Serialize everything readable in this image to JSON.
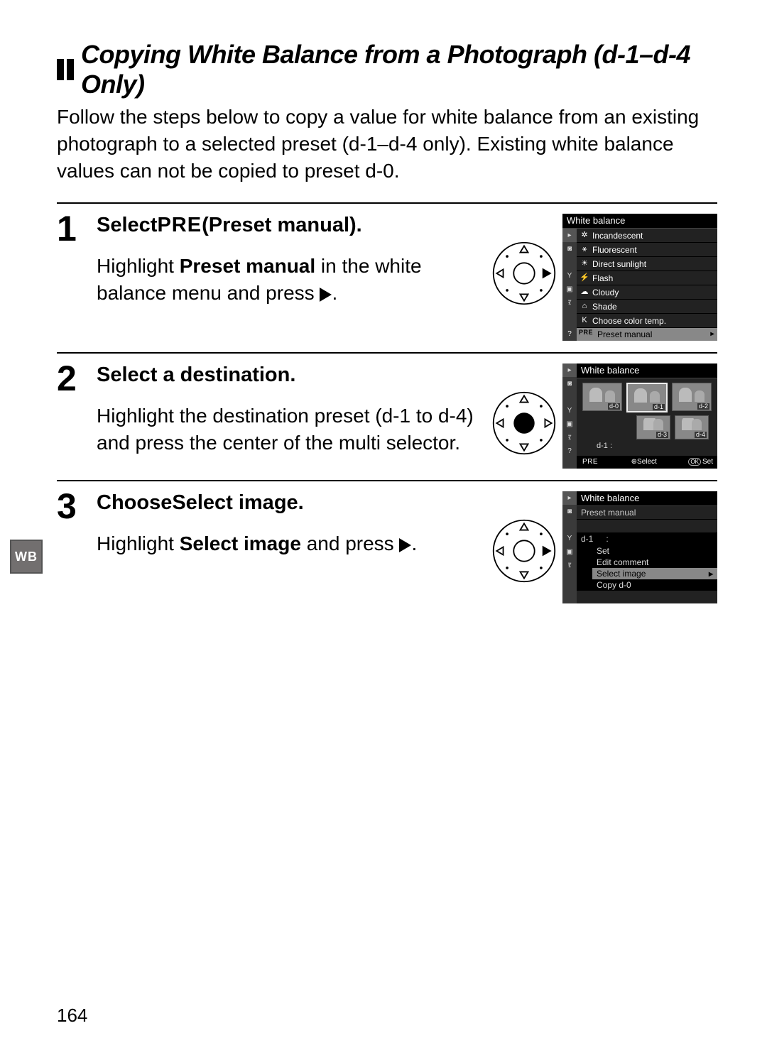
{
  "heading": "Copying White Balance from a Photograph (d-1–d-4 Only)",
  "intro": "Follow the steps below to copy a value for white balance from an existing photograph to a selected preset (d-1–d-4 only).  Existing white balance values can not be copied to preset d-0.",
  "steps": [
    {
      "num": "1",
      "title_pre": "Select ",
      "title_pre_label": "PRE",
      "title_post": " (Preset manual).",
      "desc_pre": "Highlight ",
      "desc_bold": "Preset manual",
      "desc_post": " in the white balance menu and press ",
      "desc_end": "."
    },
    {
      "num": "2",
      "title": "Select a destination.",
      "desc": "Highlight the destination preset (d-1 to d-4) and press the center of the multi selector."
    },
    {
      "num": "3",
      "title_pre": "Choose ",
      "title_bold": "Select image",
      "title_post": ".",
      "desc_pre": "Highlight ",
      "desc_bold": "Select image",
      "desc_post": " and press ",
      "desc_end": "."
    }
  ],
  "lcd1": {
    "title": "White balance",
    "items": [
      "Incandescent",
      "Fluorescent",
      "Direct sunlight",
      "Flash",
      "Cloudy",
      "Shade",
      "Choose color temp."
    ],
    "icons": [
      "✲",
      "⚹",
      "☀",
      "⚡",
      "☁",
      "⌂",
      "K"
    ],
    "selected_pre": "PRE",
    "selected_label": "Preset manual",
    "left_icons": [
      "▸",
      "◙",
      "",
      "Y",
      "▣",
      "ऱ",
      "?"
    ]
  },
  "lcd2": {
    "title": "White balance",
    "thumbs": [
      "d-0",
      "d-1",
      "d-2",
      "d-3",
      "d-4"
    ],
    "current": "d-1  :",
    "foot_pre": "PRE",
    "foot_select": "⊕Select",
    "foot_set": "Set",
    "foot_ok": "OK",
    "left_icons": [
      "▸",
      "◙",
      "",
      "Y",
      "▣",
      "ऱ",
      "?"
    ]
  },
  "lcd3": {
    "title": "White balance",
    "sub": "Preset manual",
    "d1": "d-1",
    "colon": ":",
    "items": [
      "Set",
      "Edit comment",
      "Select image",
      "Copy d-0"
    ],
    "selected_index": 2,
    "left_icons": [
      "▸",
      "◙",
      "",
      "Y",
      "▣",
      "ऱ"
    ]
  },
  "side_tab": "WB",
  "page_number": "164"
}
